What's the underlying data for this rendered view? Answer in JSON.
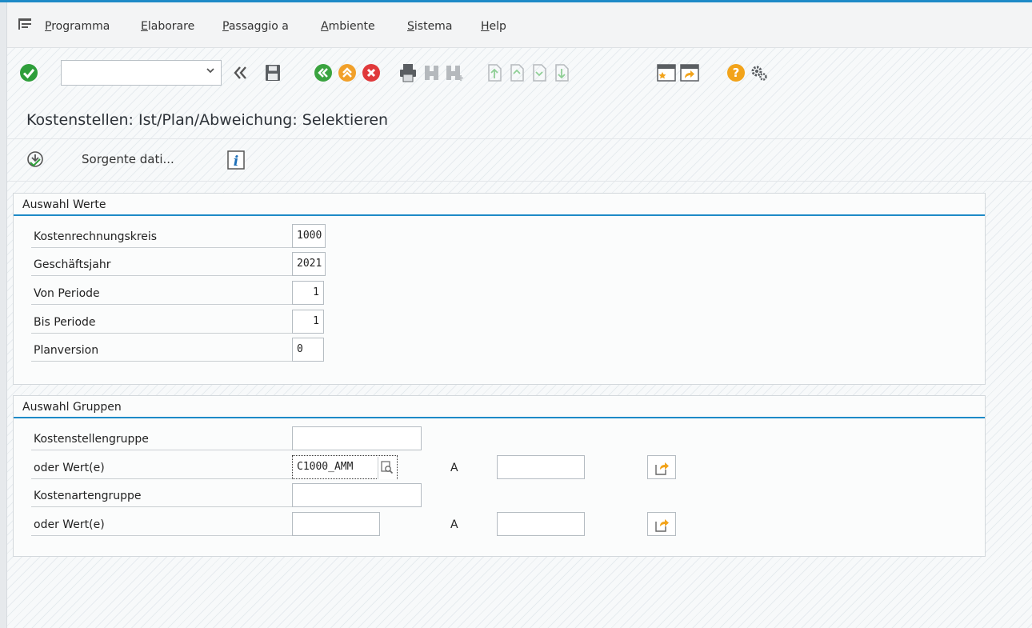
{
  "menu": {
    "items": [
      "Programma",
      "Elaborare",
      "Passaggio a",
      "Ambiente",
      "Sistema",
      "Help"
    ]
  },
  "toolbar": {
    "command_field_value": "",
    "icons": [
      "enter-check-icon",
      "command-dropdown-icon",
      "back-double-icon",
      "save-icon",
      "back-icon",
      "exit-icon",
      "cancel-icon",
      "print-icon",
      "find-icon",
      "find-next-icon",
      "first-page-icon",
      "previous-page-icon",
      "next-page-icon",
      "last-page-icon",
      "create-session-icon",
      "shortcut-icon",
      "help-icon",
      "settings-icon"
    ],
    "colors": {
      "enter": "#2e9e3a",
      "back": "#3aa33f",
      "exit": "#f1a02a",
      "cancel": "#e0393b",
      "help": "#f2a31a"
    }
  },
  "title": "Kostenstellen: Ist/Plan/Abweichung: Selektieren",
  "app_toolbar": {
    "execute_icon": "execute-clock-icon",
    "source_label": "Sorgente dati...",
    "info_icon": "info-icon"
  },
  "group_values": {
    "title": "Auswahl Werte",
    "rows": [
      {
        "label": "Kostenrechnungskreis",
        "value": "1000"
      },
      {
        "label": "Geschäftsjahr",
        "value": "2021"
      },
      {
        "label": "Von Periode",
        "value": "1"
      },
      {
        "label": "Bis Periode",
        "value": "1"
      },
      {
        "label": "Planversion",
        "value": "0"
      }
    ]
  },
  "group_groups": {
    "title": "Auswahl Gruppen",
    "rows": [
      {
        "label": "Kostenstellengruppe",
        "value": ""
      },
      {
        "label": "oder Wert(e)",
        "value": "C1000_AMM",
        "to_label": "A",
        "to_value": ""
      },
      {
        "label": "Kostenartengruppe",
        "value": ""
      },
      {
        "label": "oder Wert(e)",
        "value": "",
        "to_label": "A",
        "to_value": ""
      }
    ]
  },
  "accent_color": "#1d8ac7"
}
